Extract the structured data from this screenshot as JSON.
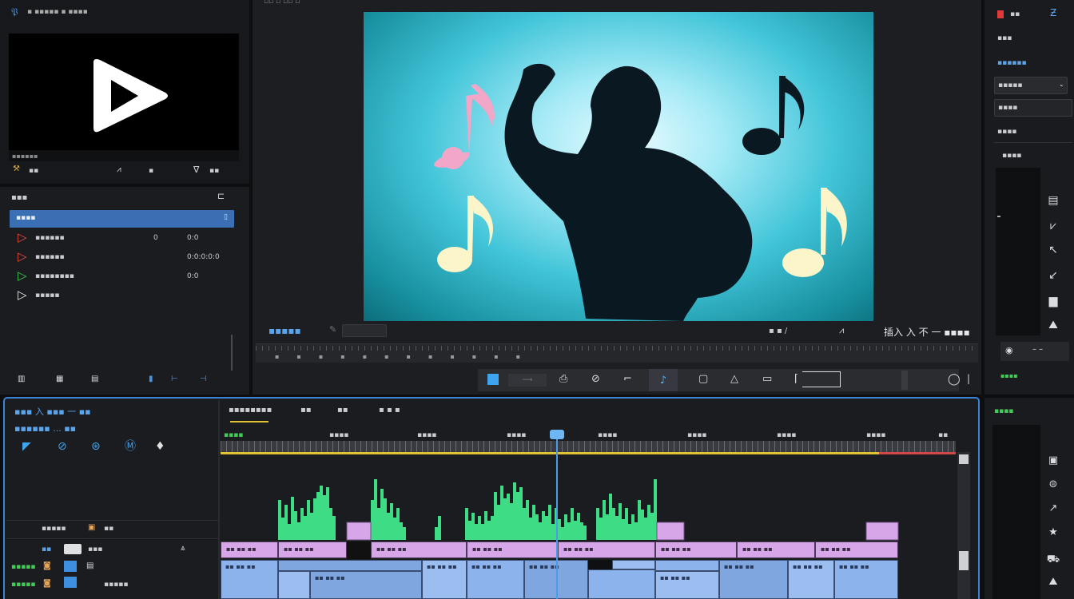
{
  "colors": {
    "accent": "#3a83d7",
    "playhead": "#4a9be8",
    "clip_pink": "#d6a6e8",
    "clip_blue": "#8cb3ec",
    "wave": "#3fdc86",
    "preview_bg": "#2fb9cf",
    "ruler_line": "#e0c235"
  },
  "topbar": {
    "app_logo": "𝔓",
    "title": "▪ ▪▪▪▪▪ ▪ ▪▪▪▪"
  },
  "source_monitor": {
    "play_icon": "play-icon",
    "footer_label": "▪▪▪▪▪▪",
    "tool_labels": [
      "▪▪",
      "▪▪",
      "▪"
    ]
  },
  "project_panel": {
    "title": "▪▪▪",
    "header_item": "▪▪▪▪",
    "items": [
      {
        "icon": "play-red-icon",
        "label": "▪▪▪▪▪▪",
        "meta1": "0",
        "meta2": "0:0"
      },
      {
        "icon": "play-red-icon",
        "label": "▪▪▪▪▪▪",
        "meta1": "",
        "meta2": "0:0:0:0:0"
      },
      {
        "icon": "play-green-icon",
        "label": "▪▪▪▪▪▪▪▪",
        "meta1": "",
        "meta2": "0:0"
      },
      {
        "icon": "play-white-icon",
        "label": "▪▪▪▪▪",
        "meta1": "",
        "meta2": ""
      }
    ]
  },
  "program_monitor": {
    "scene_label": "▪▪▪▪▪",
    "status_right": "▪▪ ▪▪ ▪▪▪▪",
    "insert_label": "插入 入 不 一 ▪▪▪▪",
    "counter": "▪ ▪ /",
    "image_description_icon": "silhouette-music-icon"
  },
  "transport": {
    "buttons": [
      "stop-square-icon",
      "loop-icon",
      "camera-icon",
      "link-icon",
      "crop-icon",
      "razor-icon",
      "frame-icon",
      "triangle-icon",
      "export-icon",
      "slip-icon",
      "end-icon",
      "record-icon"
    ]
  },
  "right_panel": {
    "header": "▪▪",
    "section1": "▪▪▪",
    "section2": "▪▪▪▪▪▪",
    "dropdown_value": "▪▪▪▪▪",
    "field": "▪▪▪▪",
    "label3": "▪▪▪▪",
    "label4": "▪▪▪▪",
    "bottom_label": "▪▪▪▪",
    "tools": [
      "flag-icon",
      "pointer-icon",
      "pen-icon",
      "slash-icon",
      "box-icon",
      "mountain-icon"
    ]
  },
  "timeline": {
    "left": {
      "line1": "▪▪▪ 入 ▪▪▪ 一 ▪▪",
      "line2": "▪▪▪▪▪▪ ... ▪▪",
      "track_header": "▪▪▪▪▪",
      "mix_label": "▪▪",
      "row1": "▪▪",
      "row2": "▪▪▪",
      "row3": "▪▪▪▪▪",
      "row4": "▪▪▪▪▪"
    },
    "tabs": [
      "▪▪▪▪▪▪▪▪",
      "▪▪",
      "▪▪",
      "▪ ▪ ▪"
    ],
    "ruler_ticks": [
      "▪▪▪▪",
      "▪▪▪▪",
      "▪▪▪▪",
      "▪▪▪▪",
      "▪▪▪▪",
      "▪▪▪▪",
      "▪▪▪▪",
      "▪▪▪▪",
      "▪▪"
    ],
    "clip_label": "▪▪ ▪▪ ▪▪",
    "right_header": "▪▪▪▪"
  }
}
